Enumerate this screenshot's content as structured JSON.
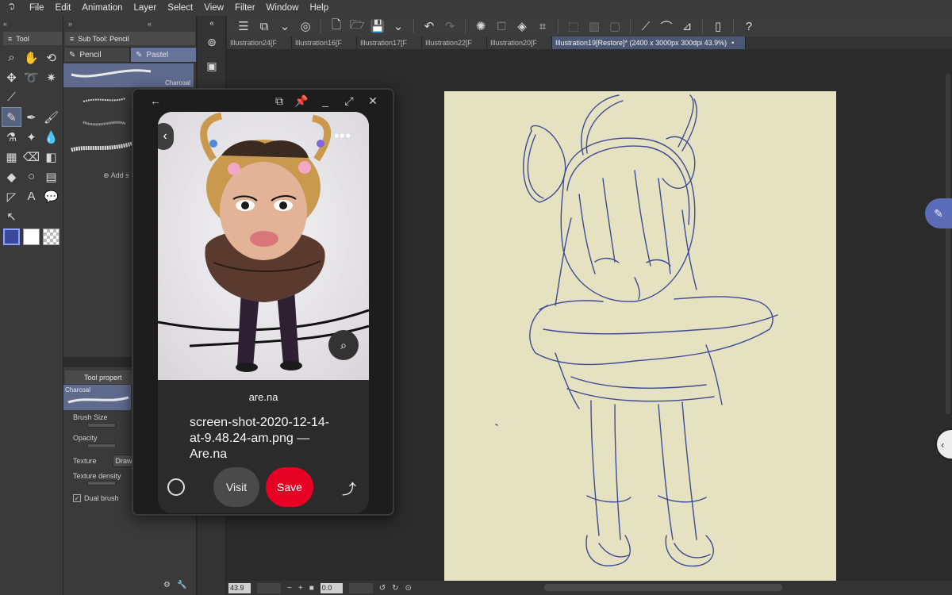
{
  "menu": {
    "items": [
      "File",
      "Edit",
      "Animation",
      "Layer",
      "Select",
      "View",
      "Filter",
      "Window",
      "Help"
    ]
  },
  "tool_panel": {
    "tab_label": "Tool"
  },
  "sub_tool": {
    "title": "Sub Tool: Pencil",
    "tabs": [
      "Pencil",
      "Pastel"
    ],
    "selected_brush": "Charcoal",
    "add_label": "Add s"
  },
  "tool_property": {
    "title": "Tool propert",
    "preview_label": "Charcoal",
    "brush_size": "Brush Size",
    "opacity": "Opacity",
    "texture": "Texture",
    "texture_button": "Draw",
    "texture_density": "Texture density",
    "dual_brush": "Dual brush",
    "dual_brush_checked": true
  },
  "document_tabs": [
    {
      "label": "Illustration24[F",
      "active": false
    },
    {
      "label": "Illustration16[F",
      "active": false
    },
    {
      "label": "Illustration17[F",
      "active": false
    },
    {
      "label": "Illustration22[F",
      "active": false
    },
    {
      "label": "Illustration20[F",
      "active": false
    },
    {
      "label": "Illustration19[Restore]* (2400 x 3000px 300dpi 43.9%)",
      "active": true
    }
  ],
  "status": {
    "zoom": "43.9",
    "rotation": "0.0"
  },
  "floating_window": {
    "source": "are.na",
    "pin_title": "screen-shot-2020-12-14-at-9.48.24-am.png — Are.na",
    "visit_label": "Visit",
    "save_label": "Save"
  },
  "colors": {
    "accent": "#5b6cb8",
    "main_color": "#3a4a9a",
    "sub_color": "#ffffff",
    "save_button": "#e60023",
    "sketch_stroke": "#2e3a8f",
    "paper": "#e5e2c2"
  },
  "icons": {
    "tools": [
      "zoom-icon",
      "hand-icon",
      "rotate-icon",
      "move-icon",
      "lasso-icon",
      "auto-select-icon",
      "eyedropper-icon",
      "pencil-icon",
      "pen-icon",
      "brush-icon",
      "airbrush-icon",
      "sparkle-icon",
      "watercolor-icon",
      "grid-icon",
      "eraser-icon",
      "blend-icon",
      "fill-icon",
      "shape-icon",
      "frame-icon",
      "ruler-icon",
      "text-icon",
      "balloon-icon",
      "correction-icon"
    ]
  }
}
